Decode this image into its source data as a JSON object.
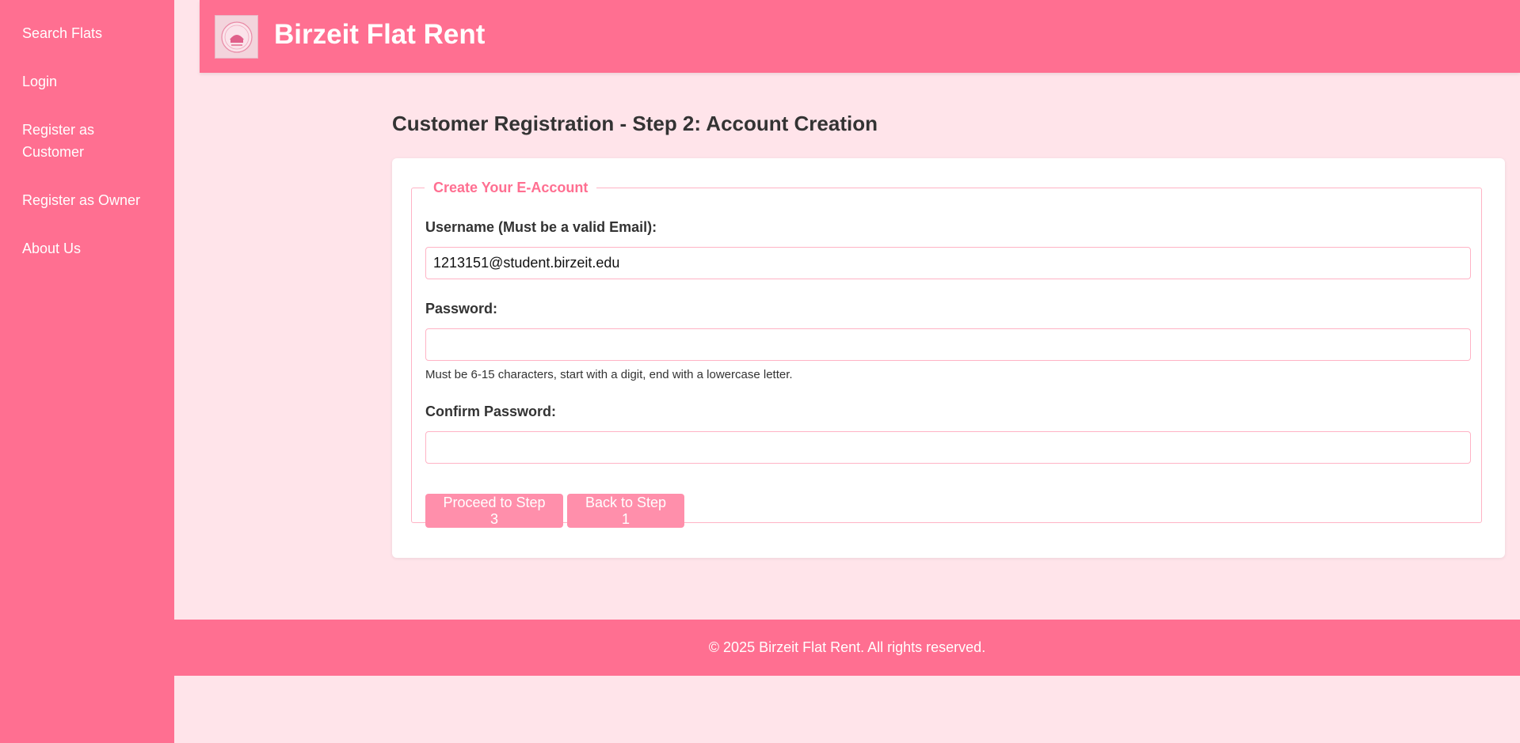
{
  "sidebar": {
    "items": [
      {
        "label": "Search Flats"
      },
      {
        "label": "Login"
      },
      {
        "label": "Register as Customer"
      },
      {
        "label": "Register as Owner"
      },
      {
        "label": "About Us"
      }
    ]
  },
  "header": {
    "logo_icon": "birzeit-flat-rent-logo",
    "title": "Birzeit Flat Rent"
  },
  "main": {
    "page_title": "Customer Registration - Step 2: Account Creation",
    "form": {
      "legend": "Create Your E-Account",
      "username": {
        "label": "Username (Must be a valid Email):",
        "value": "1213151@student.birzeit.edu",
        "placeholder": ""
      },
      "password": {
        "label": "Password:",
        "value": "",
        "hint": "Must be 6-15 characters, start with a digit, end with a lowercase letter."
      },
      "confirm_password": {
        "label": "Confirm Password:",
        "value": ""
      },
      "buttons": {
        "proceed": "Proceed to Step 3",
        "back": "Back to Step 1"
      }
    }
  },
  "footer": {
    "text": "© 2025 Birzeit Flat Rent. All rights reserved."
  },
  "colors": {
    "primary": "#ff6f91",
    "background": "#ffe4ea",
    "button": "#ff8fab",
    "input_border": "#ffb3c5"
  }
}
